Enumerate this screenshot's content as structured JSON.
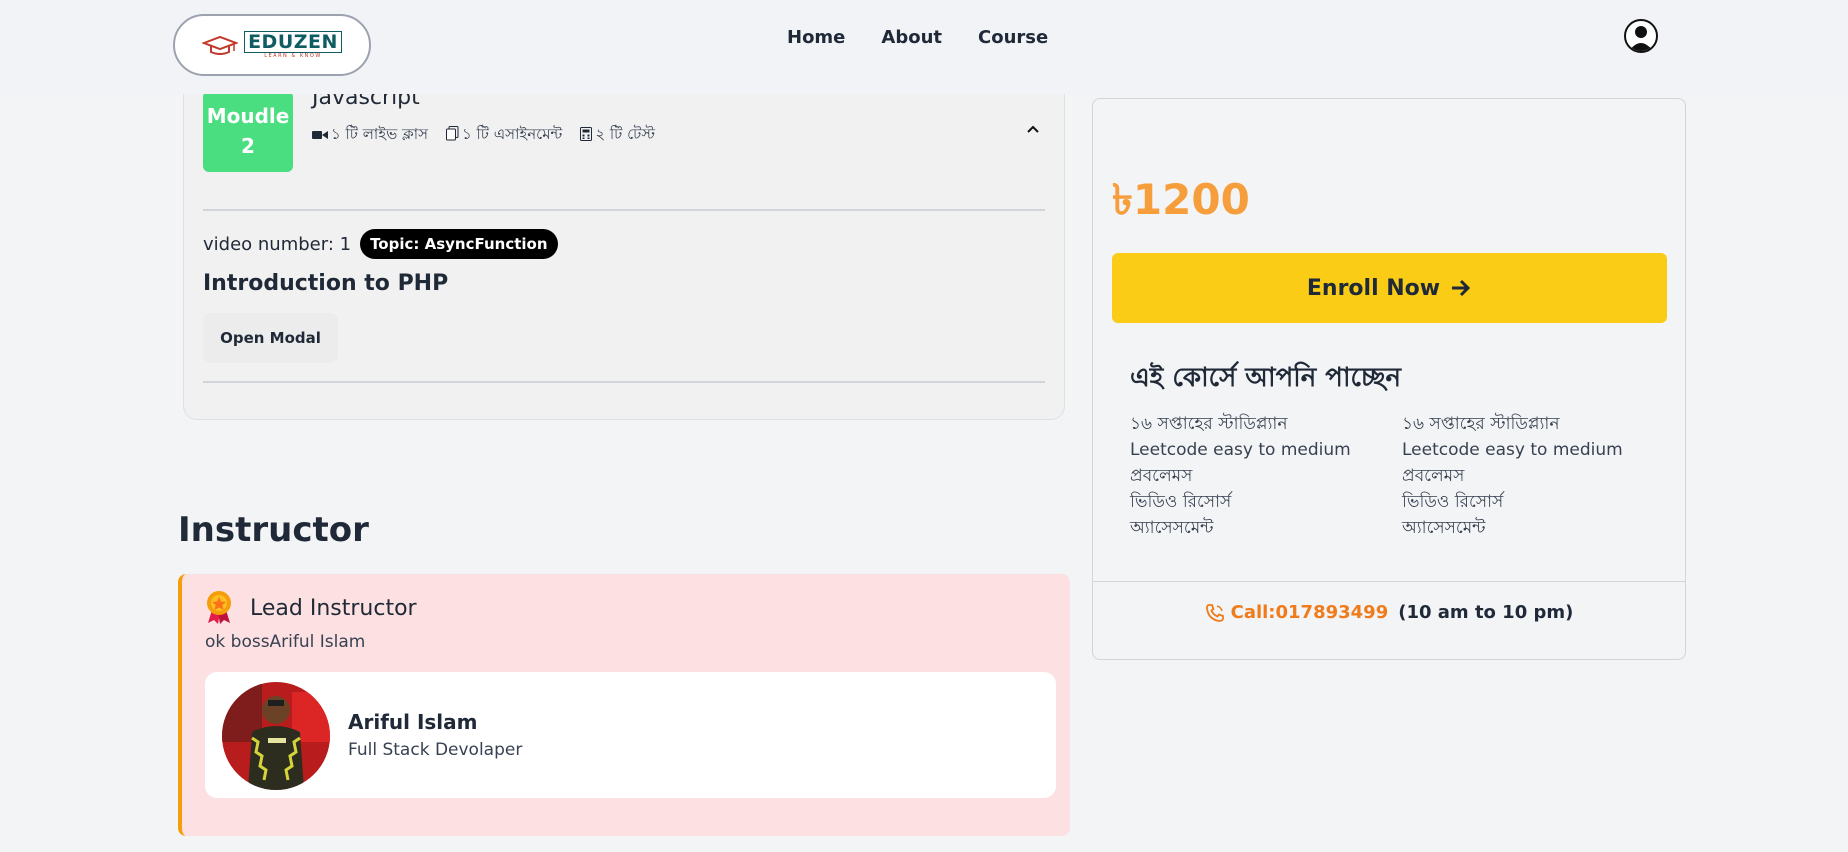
{
  "header": {
    "logo": {
      "word": "EDUZEN",
      "tagline": "LEARN & KNOW"
    },
    "nav": [
      "Home",
      "About",
      "Course"
    ],
    "icons": {
      "profile": "user-avatar-icon"
    }
  },
  "module": {
    "badge_line1": "Moudle",
    "badge_line2": "2",
    "title": "Javascript",
    "meta": [
      {
        "icon": "video-icon",
        "text": "১ টি লাইভ ক্লাস"
      },
      {
        "icon": "copy-icon",
        "text": "১ টি এসাইনমেন্ট"
      },
      {
        "icon": "calculator-icon",
        "text": "২ টি টেস্ট"
      }
    ],
    "video_number": "video number: 1",
    "topic": "Topic: AsyncFunction",
    "lesson_title": "Introduction to PHP",
    "open_modal": "Open Modal"
  },
  "instructor": {
    "heading": "Instructor",
    "lead_title": "Lead Instructor",
    "lead_desc": "ok bossAriful Islam",
    "name": "Ariful Islam",
    "role": "Full Stack Devolaper"
  },
  "sidebar": {
    "price": "৳1200",
    "enroll": "Enroll Now",
    "benefit_title": "এই কোর্সে আপনি পাচ্ছেন",
    "benefits_left": [
      "১৬ সপ্তাহের স্টাডিপ্ল্যান",
      "Leetcode easy to medium প্রবলেমস",
      "ভিডিও রিসোর্স",
      "অ্যাসেসমেন্ট"
    ],
    "benefits_right": [
      "১৬ সপ্তাহের স্টাডিপ্ল্যান",
      "Leetcode easy to medium প্রবলেমস",
      "ভিডিও রিসোর্স",
      "অ্যাসেসমেন্ট"
    ],
    "call": "Call:017893499",
    "hours": "(10 am to 10 pm)"
  },
  "colors": {
    "module_badge": "#4ade80",
    "price": "#f59e3b",
    "enroll": "#facc15",
    "lead_bg": "#fde1e2",
    "call": "#f07b1b"
  }
}
